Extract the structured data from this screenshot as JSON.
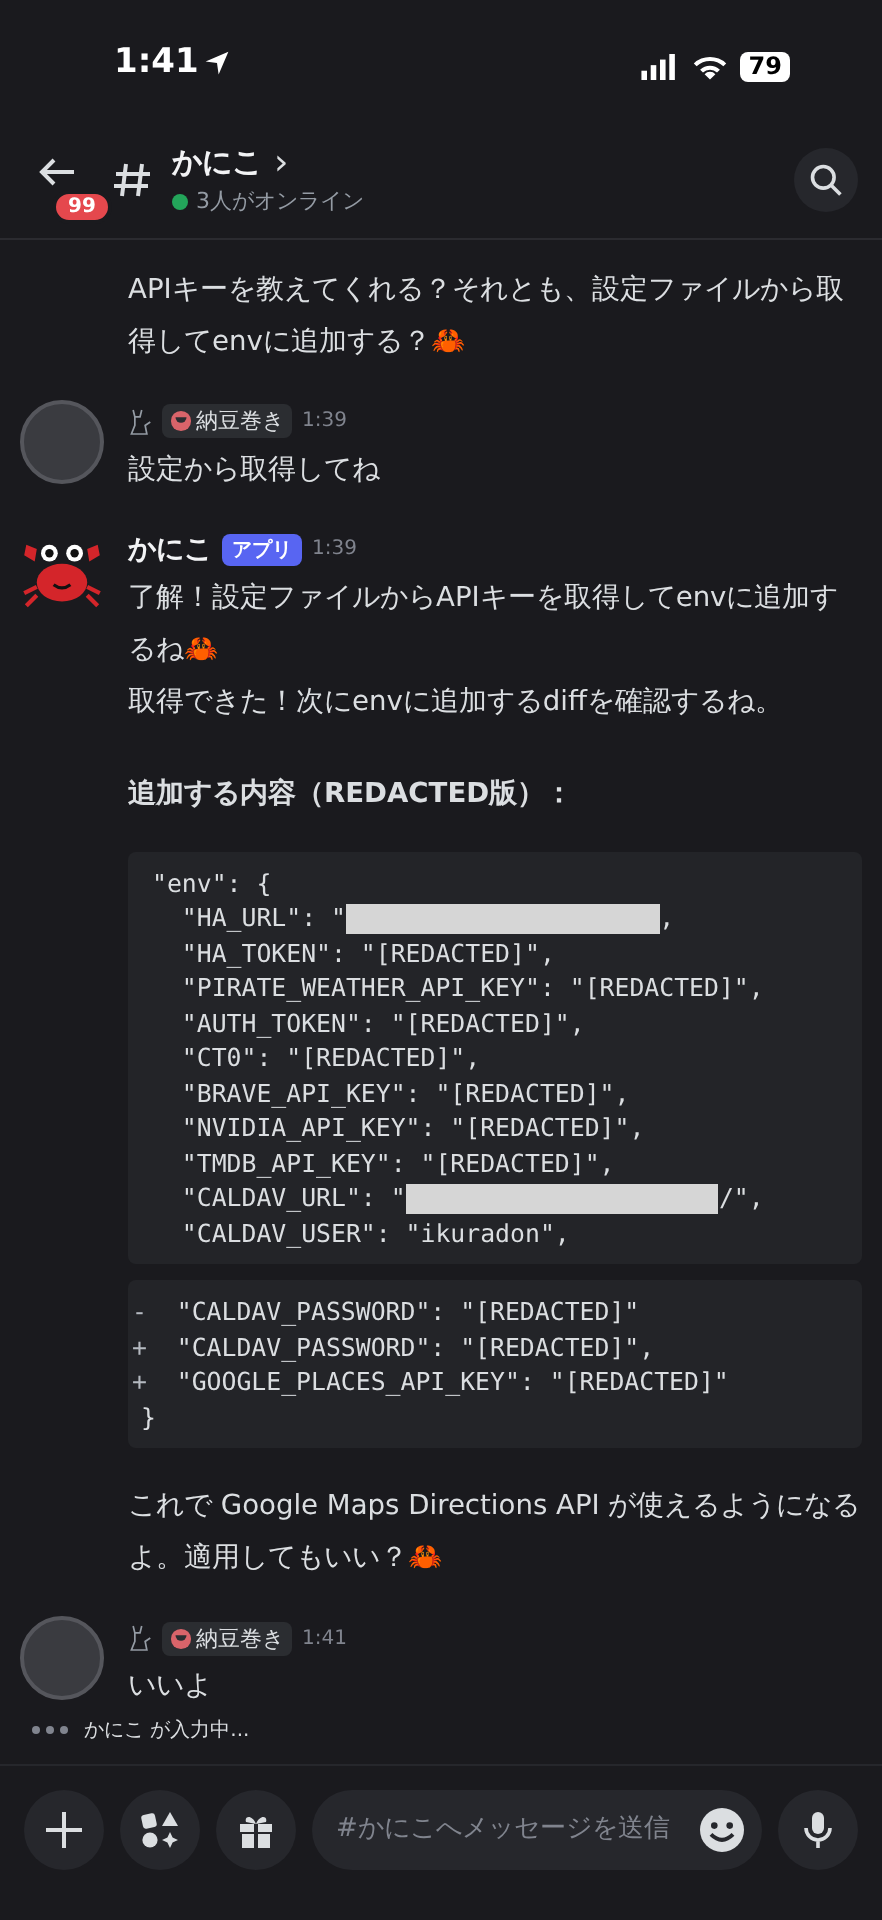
{
  "status_bar": {
    "time": "1:41",
    "battery": "79"
  },
  "header": {
    "unread_badge": "99",
    "channel": "かにこ",
    "chevron": "›",
    "online": "3人がオンライン"
  },
  "messages": [
    {
      "kind": "continuation",
      "blocks": [
        {
          "kind": "paragraph",
          "text": "APIキーを教えてくれる？それとも、設定ファイルから取得してenvに追加する？🦀"
        }
      ]
    },
    {
      "kind": "user",
      "role_tag": "納豆巻き",
      "time": "1:39",
      "blocks": [
        {
          "kind": "paragraph",
          "text": "設定から取得してね"
        }
      ]
    },
    {
      "kind": "app",
      "author": "かにこ",
      "badge": "アプリ",
      "time": "1:39",
      "blocks": [
        {
          "kind": "paragraph",
          "text": "了解！設定ファイルからAPIキーを取得してenvに追加するね🦀"
        },
        {
          "kind": "paragraph",
          "text": "取得できた！次にenvに追加するdiffを確認するね。"
        },
        {
          "kind": "heading",
          "text": "追加する内容（REDACTED版）："
        },
        {
          "kind": "code",
          "lines": [
            {
              "text": "\"env\": {",
              "children": [
                {
                  "segments": [
                    {
                      "kind": "text",
                      "text": "\"HA_URL\": \""
                    },
                    {
                      "kind": "redacted"
                    },
                    {
                      "kind": "text",
                      "text": ","
                    }
                  ]
                },
                {
                  "text": "\"HA_TOKEN\": \"[REDACTED]\","
                },
                {
                  "text": "\"PIRATE_WEATHER_API_KEY\": \"[REDACTED]\","
                },
                {
                  "text": "\"AUTH_TOKEN\": \"[REDACTED]\","
                },
                {
                  "text": "\"CT0\": \"[REDACTED]\","
                },
                {
                  "text": "\"BRAVE_API_KEY\": \"[REDACTED]\","
                },
                {
                  "text": "\"NVIDIA_API_KEY\": \"[REDACTED]\","
                },
                {
                  "text": "\"TMDB_API_KEY\": \"[REDACTED]\","
                },
                {
                  "segments": [
                    {
                      "kind": "text",
                      "text": "\"CALDAV_URL\": \""
                    },
                    {
                      "kind": "redacted"
                    },
                    {
                      "kind": "text",
                      "text": "/\","
                    }
                  ]
                },
                {
                  "text": "\"CALDAV_USER\": \"ikuradon\","
                }
              ]
            }
          ]
        },
        {
          "kind": "diff",
          "lines": [
            {
              "marker": "-",
              "text": "\"CALDAV_PASSWORD\": \"[REDACTED]\""
            },
            {
              "marker": "+",
              "text": "\"CALDAV_PASSWORD\": \"[REDACTED]\","
            },
            {
              "marker": "+",
              "text": "\"GOOGLE_PLACES_API_KEY\": \"[REDACTED]\""
            },
            {
              "text": "}"
            }
          ]
        }
      ]
    },
    {
      "kind": "continuation",
      "blocks": [
        {
          "kind": "paragraph",
          "text": "これで Google Maps Directions API が使えるようになるよ。適用してもいい？🦀"
        }
      ]
    },
    {
      "kind": "user",
      "role_tag": "納豆巻き",
      "time": "1:41",
      "blocks": [
        {
          "kind": "paragraph",
          "text": "いいよ"
        }
      ]
    }
  ],
  "typing": "かにこ が入力中...",
  "composer": {
    "placeholder": "#かにこへメッセージを送信"
  }
}
